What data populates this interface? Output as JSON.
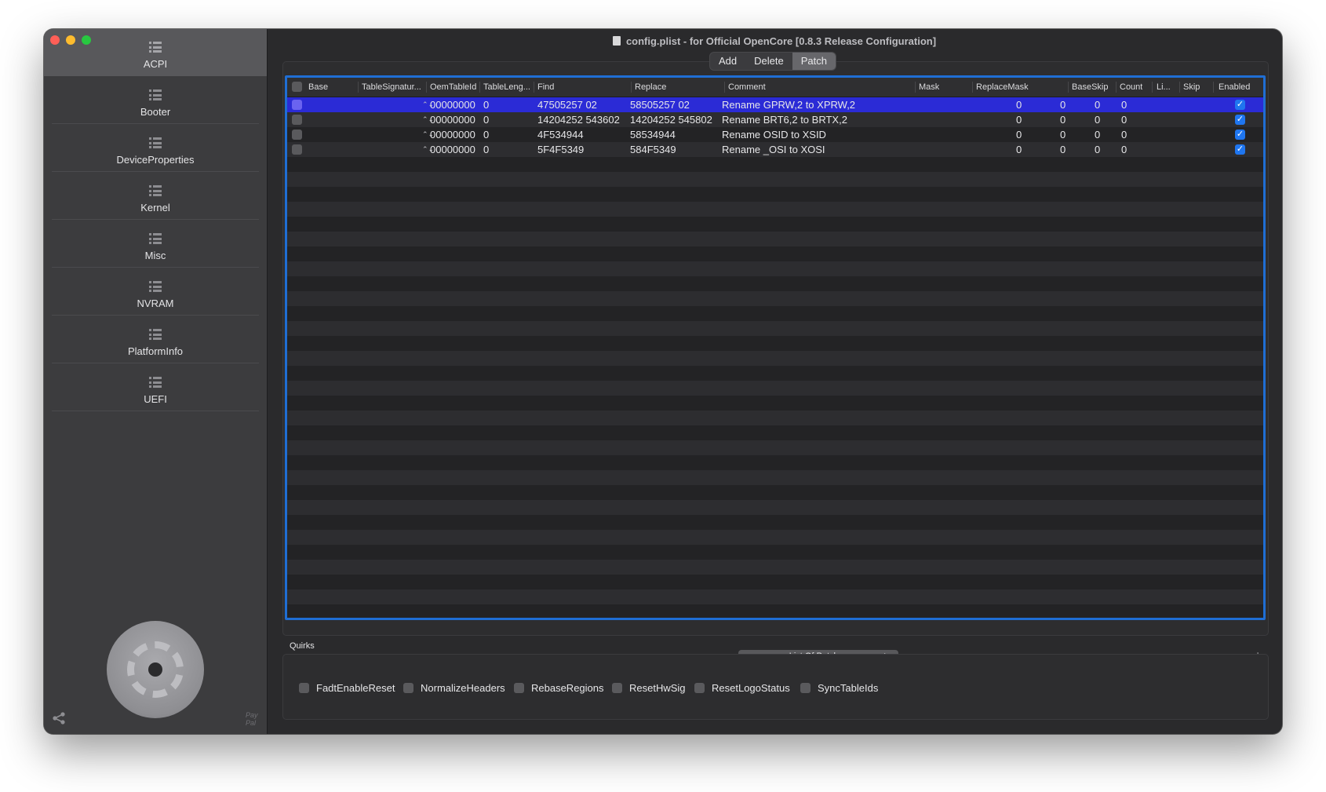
{
  "window": {
    "title": "config.plist - for Official OpenCore [0.8.3 Release Configuration]"
  },
  "sidebar": {
    "items": [
      {
        "label": "ACPI",
        "icon": "list-icon",
        "selected": true
      },
      {
        "label": "Booter",
        "icon": "list-icon",
        "selected": false
      },
      {
        "label": "DeviceProperties",
        "icon": "list-icon",
        "selected": false
      },
      {
        "label": "Kernel",
        "icon": "list-icon",
        "selected": false
      },
      {
        "label": "Misc",
        "icon": "list-icon",
        "selected": false
      },
      {
        "label": "NVRAM",
        "icon": "list-icon",
        "selected": false
      },
      {
        "label": "PlatformInfo",
        "icon": "list-icon",
        "selected": false
      },
      {
        "label": "UEFI",
        "icon": "list-icon",
        "selected": false
      }
    ],
    "paypal_label": "Pay Pal"
  },
  "segmented": {
    "tabs": [
      "Add",
      "Delete",
      "Patch"
    ],
    "active": "Patch"
  },
  "table": {
    "columns": [
      "Base",
      "TableSignatur...",
      "OemTableId",
      "TableLeng...",
      "Find",
      "Replace",
      "Comment",
      "Mask",
      "ReplaceMask",
      "BaseSkip",
      "Count",
      "Li...",
      "Skip",
      "Enabled"
    ],
    "rows": [
      {
        "base_checked": false,
        "oem": "00000000",
        "tlen": "0",
        "find": "47505257 02",
        "replace": "58505257 02",
        "comment": "Rename GPRW,2 to XPRW,2",
        "mask": "",
        "rmask": "",
        "baseskip": "0",
        "count": "0",
        "limit": "0",
        "skip": "0",
        "enabled": true,
        "selected": true
      },
      {
        "base_checked": false,
        "oem": "00000000",
        "tlen": "0",
        "find": "14204252 543602",
        "replace": "14204252 545802",
        "comment": "Rename BRT6,2 to BRTX,2",
        "mask": "",
        "rmask": "",
        "baseskip": "0",
        "count": "0",
        "limit": "0",
        "skip": "0",
        "enabled": true,
        "selected": false
      },
      {
        "base_checked": false,
        "oem": "00000000",
        "tlen": "0",
        "find": "4F534944",
        "replace": "58534944",
        "comment": "Rename OSID to XSID",
        "mask": "",
        "rmask": "",
        "baseskip": "0",
        "count": "0",
        "limit": "0",
        "skip": "0",
        "enabled": true,
        "selected": false
      },
      {
        "base_checked": false,
        "oem": "00000000",
        "tlen": "0",
        "find": "5F4F5349",
        "replace": "584F5349",
        "comment": "Rename _OSI to XOSI",
        "mask": "",
        "rmask": "",
        "baseskip": "0",
        "count": "0",
        "limit": "0",
        "skip": "0",
        "enabled": true,
        "selected": false
      }
    ],
    "stepper_glyph": "⌃⌄",
    "enabled_glyph": "✓"
  },
  "list_popup": {
    "value": "List Of Patches"
  },
  "row_buttons": {
    "remove": "—",
    "add": "+"
  },
  "quirks": {
    "label": "Quirks",
    "items": [
      {
        "label": "FadtEnableReset",
        "checked": false
      },
      {
        "label": "NormalizeHeaders",
        "checked": false
      },
      {
        "label": "RebaseRegions",
        "checked": false
      },
      {
        "label": "ResetHwSig",
        "checked": false
      },
      {
        "label": "ResetLogoStatus",
        "checked": false
      },
      {
        "label": "SyncTableIds",
        "checked": false
      }
    ]
  },
  "colors": {
    "selection": "#2b2bd6",
    "table_focus_border": "#1f6ed4",
    "checkbox_on": "#1f76f0",
    "close": "#ff5f57",
    "minimize": "#febc2e",
    "zoom": "#28c840"
  }
}
